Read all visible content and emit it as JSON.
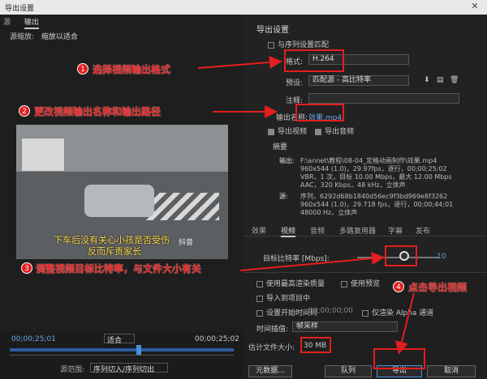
{
  "titlebar": {
    "title": "导出设置",
    "close": "✕"
  },
  "source": {
    "tabs": [
      "源",
      "输出"
    ],
    "scale_label": "源缩放:",
    "scale_value": "缩放以适合"
  },
  "video": {
    "sub1": "下车后没有关心小孩是否受伤",
    "sub2": "反而斥责家长",
    "watermark": "抖音"
  },
  "timeline": {
    "tc_left": "00;00;25;01",
    "tc_right": "00;00;25;02",
    "zoom": "适合",
    "range_label": "源范围:",
    "range_value": "序列切入/序列切出"
  },
  "export": {
    "header": "导出设置",
    "match_seq": "与序列设置匹配",
    "format_label": "格式:",
    "format_value": "H.264",
    "preset_label": "预设:",
    "preset_value": "匹配源 - 高比特率",
    "comment_label": "注释:",
    "outname_label": "输出名称:",
    "outname_value": "效果.mp4",
    "export_video": "导出视频",
    "export_audio": "导出音频",
    "summary_header": "摘要",
    "out_label": "输出:",
    "out_text": "F:\\annet\\教程\\08-04_定格动画制作\\效果.mp4\n960x544 (1.0)，29.97fps，逐行，00;00;25;02\nVBR，1 次，目标 10.00 Mbps，最大 12.00 Mbps\nAAC，320 Kbps，48 kHz，立体声",
    "src_label": "源:",
    "src_text": "序列，6292d68b1840d56ec9f3bd969e8f3262\n960x544 (1.0)，29.718 fps，逐行，00;00;44;01\n48000 Hz，立体声"
  },
  "tabs": [
    "效果",
    "视频",
    "音频",
    "多路复用器",
    "字幕",
    "发布"
  ],
  "bitrate": {
    "label": "目标比特率 [Mbps]:",
    "value": "10"
  },
  "options": {
    "max_render": "使用最高渲染质量",
    "use_preview": "使用预览",
    "import_project": "导入到项目中",
    "set_start_tc": "设置开始时间码",
    "tc_value": "00;00;00;00",
    "alpha": "仅渲染 Alpha 通道",
    "interp_label": "时间插值:",
    "interp_value": "帧采样",
    "size_label": "估计文件大小:",
    "size_value": "30 MB"
  },
  "buttons": {
    "metadata": "元数据...",
    "queue": "队列",
    "export": "导出",
    "cancel": "取消"
  },
  "annotations": {
    "a1": "选择视频输出格式",
    "n1": "1",
    "a2": "更改视频输出名称和输出路径",
    "n2": "2",
    "a3": "调整视频目标比特率，与文件大小有关",
    "n3": "3",
    "a4": "点击导出视频",
    "n4": "4"
  },
  "colors": {
    "accent": "#e41e1e",
    "link": "#6aa6e8"
  }
}
